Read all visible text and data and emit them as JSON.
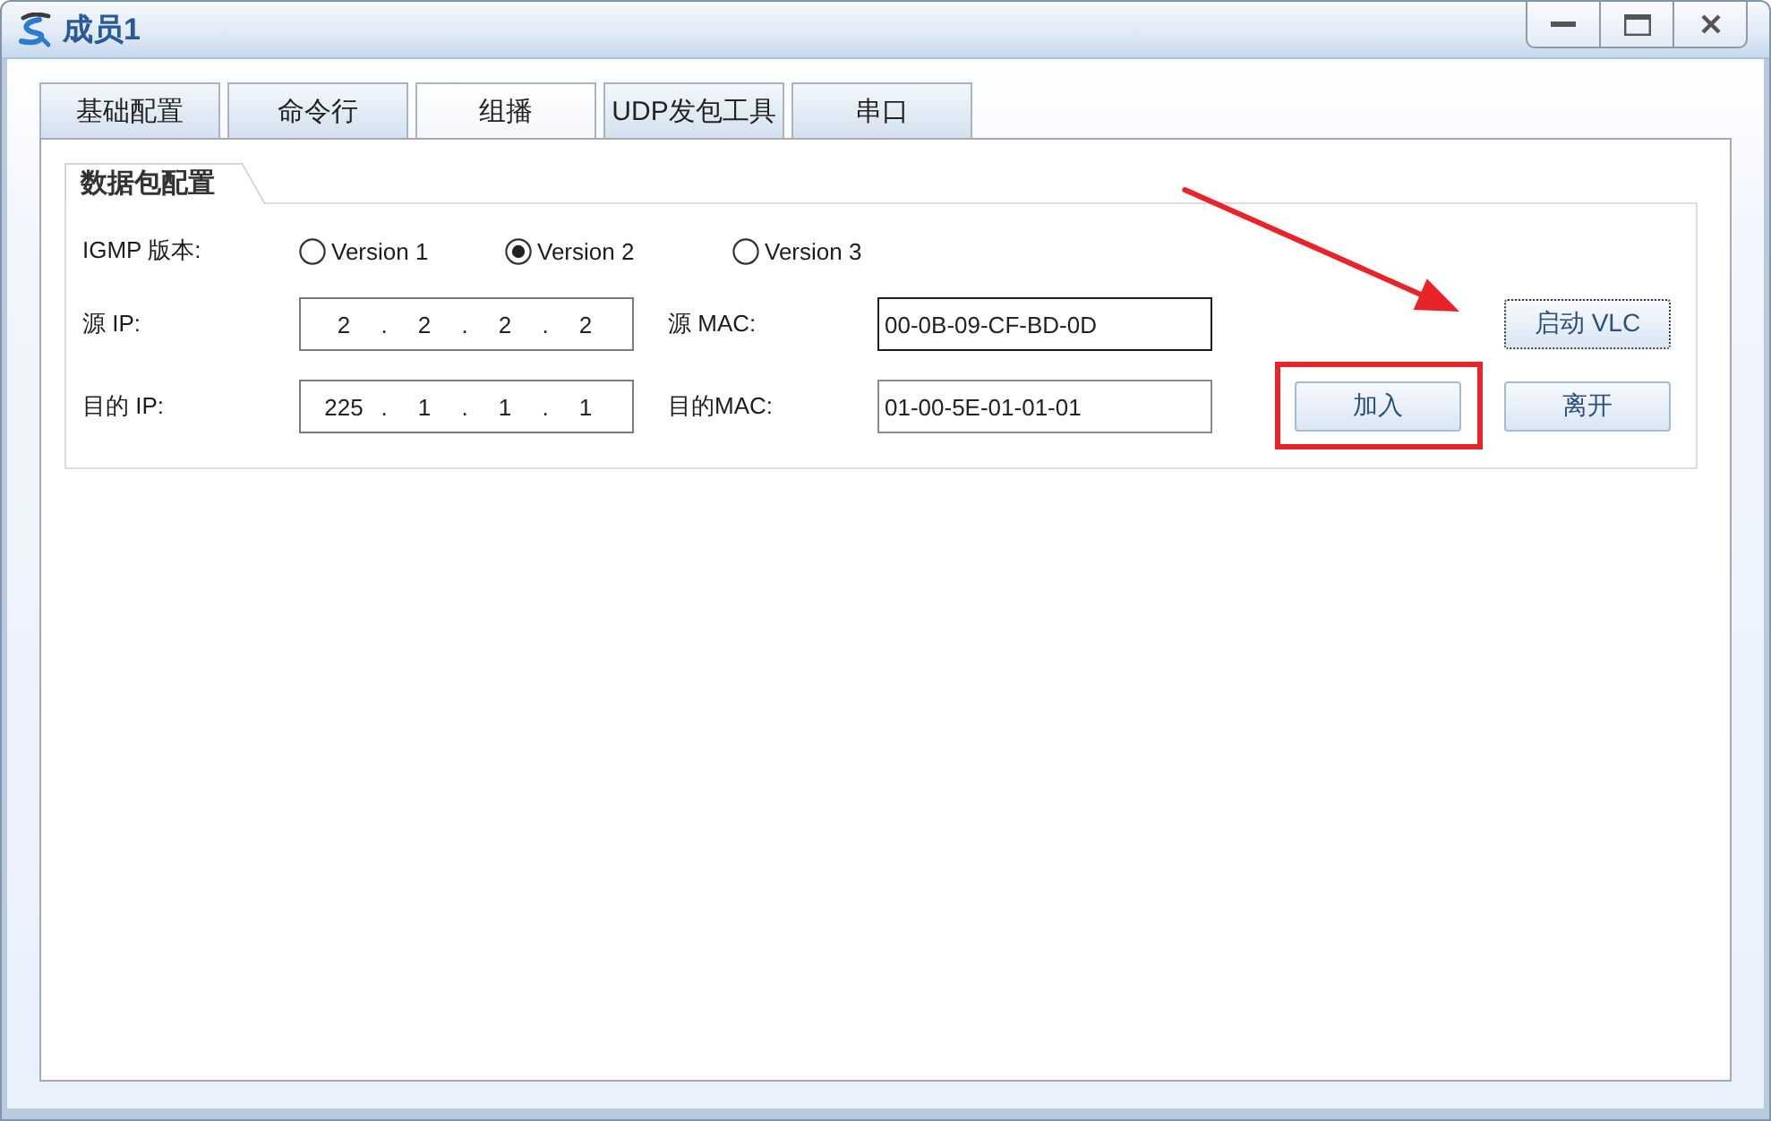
{
  "window": {
    "title": "成员1"
  },
  "tabs": [
    {
      "label": "基础配置",
      "selected": false
    },
    {
      "label": "命令行",
      "selected": false
    },
    {
      "label": "组播",
      "selected": true
    },
    {
      "label": "UDP发包工具",
      "selected": false
    },
    {
      "label": "串口",
      "selected": false
    }
  ],
  "packet_config": {
    "title": "数据包配置",
    "igmp_version": {
      "label": "IGMP 版本:",
      "options": [
        {
          "label": "Version 1",
          "selected": false
        },
        {
          "label": "Version 2",
          "selected": true
        },
        {
          "label": "Version 3",
          "selected": false
        }
      ]
    },
    "rows": [
      {
        "ip_label": "源 IP:",
        "ip": {
          "parts": [
            {
              "kind": "octet",
              "text": "2"
            },
            {
              "kind": "dot",
              "text": "."
            },
            {
              "kind": "octet",
              "text": "2"
            },
            {
              "kind": "dot",
              "text": "."
            },
            {
              "kind": "octet",
              "text": "2"
            },
            {
              "kind": "dot",
              "text": "."
            },
            {
              "kind": "octet",
              "text": "2"
            }
          ]
        },
        "mac_label": "源 MAC:",
        "mac": {
          "value": "00-0B-09-CF-BD-0D",
          "focused": true
        },
        "buttons": [
          {
            "label": "启动 VLC",
            "focused": true,
            "highlighted": false,
            "pointed_by_arrow": true
          }
        ]
      },
      {
        "ip_label": "目的 IP:",
        "ip": {
          "parts": [
            {
              "kind": "octet",
              "text": "225"
            },
            {
              "kind": "dot",
              "text": "."
            },
            {
              "kind": "octet",
              "text": "1"
            },
            {
              "kind": "dot",
              "text": "."
            },
            {
              "kind": "octet",
              "text": "1"
            },
            {
              "kind": "dot",
              "text": "."
            },
            {
              "kind": "octet",
              "text": "1"
            }
          ]
        },
        "mac_label": "目的MAC:",
        "mac": {
          "value": "01-00-5E-01-01-01",
          "focused": false
        },
        "buttons": [
          {
            "label": "加入",
            "focused": false,
            "highlighted": true,
            "pointed_by_arrow": false
          },
          {
            "label": "离开",
            "focused": false,
            "highlighted": false,
            "pointed_by_arrow": false
          }
        ]
      }
    ]
  }
}
